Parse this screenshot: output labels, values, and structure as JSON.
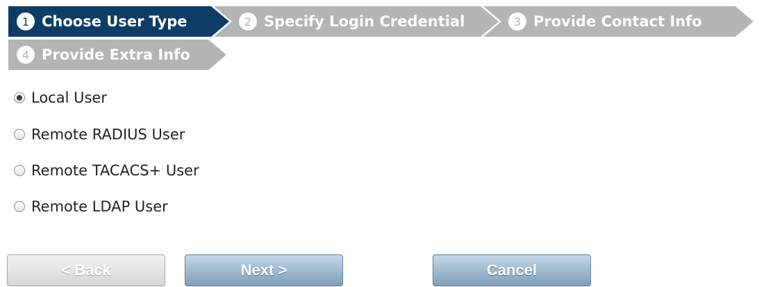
{
  "wizard": {
    "steps": [
      {
        "number": "1",
        "label": "Choose User Type",
        "state": "active"
      },
      {
        "number": "2",
        "label": "Specify Login Credential",
        "state": "inactive"
      },
      {
        "number": "3",
        "label": "Provide Contact Info",
        "state": "inactive"
      },
      {
        "number": "4",
        "label": "Provide Extra Info",
        "state": "inactive"
      }
    ]
  },
  "user_type": {
    "selected": "Local User",
    "options": [
      {
        "label": "Local User",
        "checked": true
      },
      {
        "label": "Remote RADIUS User",
        "checked": false
      },
      {
        "label": "Remote TACACS+ User",
        "checked": false
      },
      {
        "label": "Remote LDAP User",
        "checked": false
      }
    ]
  },
  "buttons": {
    "back": "< Back",
    "next": "Next >",
    "cancel": "Cancel"
  },
  "colors": {
    "active_step": "#0d3d66",
    "inactive_step": "#b4b4b4",
    "primary_button": "#7f9fbb"
  }
}
